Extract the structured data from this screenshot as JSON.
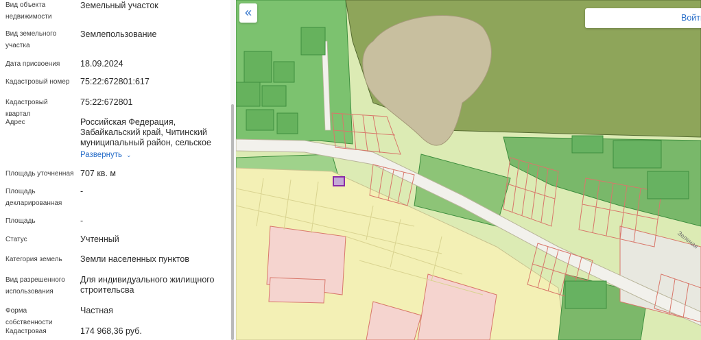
{
  "panel": {
    "rows": [
      {
        "label": "Вид объекта недвижимости",
        "value": "Земельный участок"
      },
      {
        "label": "Вид земельного участка",
        "value": "Землепользование"
      },
      {
        "label": "Дата присвоения",
        "value": "18.09.2024"
      },
      {
        "label": "Кадастровый номер",
        "value": "75:22:672801:617"
      },
      {
        "label": "Кадастровый квартал",
        "value": "75:22:672801"
      },
      {
        "label": "Адрес",
        "value": "Российская Федерация, Забайкальский край, Читинский муниципальный район, сельское"
      },
      {
        "label": "Площадь уточненная",
        "value": "707 кв. м"
      },
      {
        "label": "Площадь декларированная",
        "value": "-"
      },
      {
        "label": "Площадь",
        "value": "-"
      },
      {
        "label": "Статус",
        "value": "Учтенный"
      },
      {
        "label": "Категория земель",
        "value": "Земли населенных пунктов"
      },
      {
        "label": "Вид разрешенного использования",
        "value": "Для индивидуального жилищного строительсва"
      },
      {
        "label": "Форма собственности",
        "value": "Частная"
      },
      {
        "label": "Кадастровая",
        "value": "174 968,36 руб."
      }
    ],
    "expand_label": "Развернуть",
    "expand_icon": "chevron-down-icon"
  },
  "map": {
    "collapse_icon": "double-chevron-left-icon",
    "collapse_glyph": "«",
    "login_label": "Войти",
    "street_label": "Зеленая",
    "colors": {
      "forest": "#8ca35a",
      "green": "#6fc26a",
      "light_green": "#b9d98a",
      "yellow": "#f3f0b5",
      "pink": "#f5d4cf",
      "parcel_outline_red": "#d8776a",
      "parcel_outline_green": "#3e8e3e",
      "road": "#f4f4f0",
      "selected_parcel": "#8a2aa8"
    }
  }
}
